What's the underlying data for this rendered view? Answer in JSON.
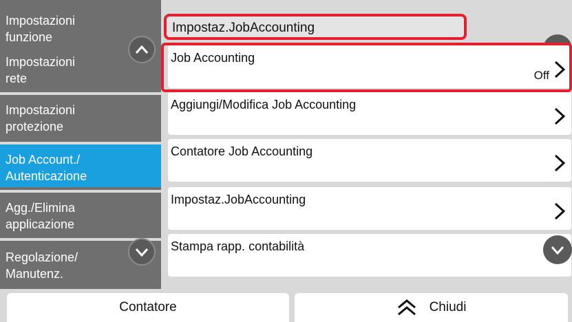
{
  "sidebar": {
    "items": [
      {
        "line1": "Impostazioni",
        "line2": "funzione"
      },
      {
        "line1": "Impostazioni",
        "line2": "rete"
      },
      {
        "line1": "Impostazioni",
        "line2": "protezione"
      },
      {
        "line1": "Job Account./",
        "line2": "Autenticazione"
      },
      {
        "line1": "Agg./Elimina",
        "line2": "applicazione"
      },
      {
        "line1": "Regolazione/",
        "line2": "Manutenz."
      }
    ]
  },
  "main": {
    "title": "Impostaz.JobAccounting",
    "rows": [
      {
        "label": "Job Accounting",
        "value": "Off"
      },
      {
        "label": "Aggiungi/Modifica Job Accounting",
        "value": ""
      },
      {
        "label": "Contatore Job Accounting",
        "value": ""
      },
      {
        "label": "Impostaz.JobAccounting",
        "value": ""
      },
      {
        "label": "Stampa rapp. contabilità",
        "value": ""
      }
    ]
  },
  "bottom": {
    "counter_label": "Contatore",
    "close_label": "Chiudi"
  },
  "colors": {
    "selected": "#1aa0df",
    "highlight": "#e5202e",
    "sidebar_bg": "#6f6f6f"
  }
}
